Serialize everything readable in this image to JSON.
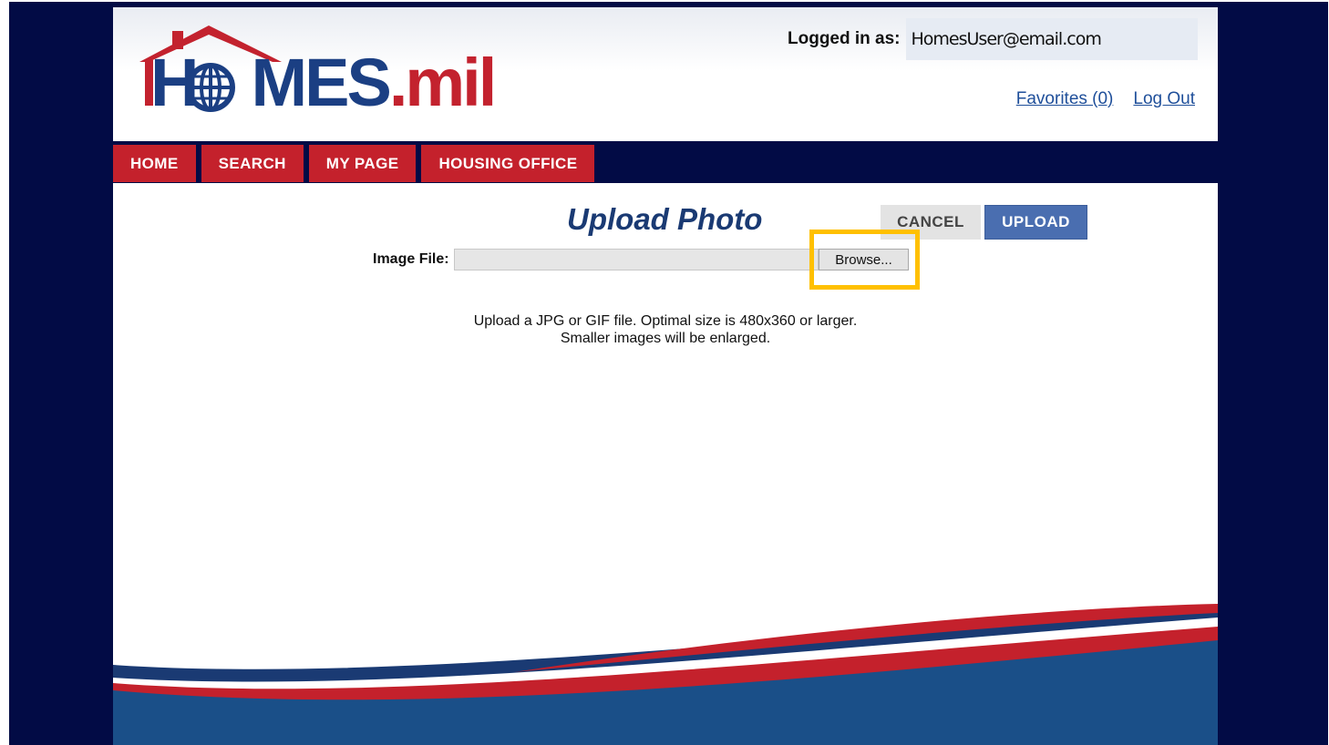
{
  "logo": {
    "left": "H",
    "middle": "MES",
    "suffix": ".mil"
  },
  "header": {
    "logged_in_label": "Logged in as:",
    "user_email": "HomesUser@email.com",
    "favorites_link": "Favorites (0)",
    "logout_link": "Log Out"
  },
  "nav": {
    "items": [
      {
        "label": "HOME"
      },
      {
        "label": "SEARCH"
      },
      {
        "label": "MY PAGE"
      },
      {
        "label": "HOUSING OFFICE"
      }
    ]
  },
  "main": {
    "title": "Upload Photo",
    "cancel_label": "CANCEL",
    "upload_label": "UPLOAD",
    "file_label": "Image File:",
    "file_value": "",
    "browse_label": "Browse...",
    "help_line1": "Upload a JPG or GIF file. Optimal size is 480x360 or larger.",
    "help_line2": "Smaller images will be enlarged."
  },
  "colors": {
    "navy": "#020b45",
    "brand_red": "#c4212c",
    "brand_blue": "#1b3f83",
    "upload_button": "#4a6eb0",
    "highlight": "#ffc000"
  }
}
